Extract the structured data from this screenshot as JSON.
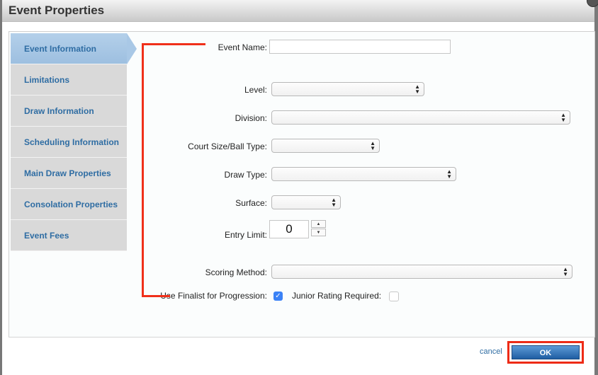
{
  "dialog": {
    "title": "Event Properties"
  },
  "sidebar": {
    "items": [
      {
        "label": "Event Information",
        "active": true
      },
      {
        "label": "Limitations",
        "active": false
      },
      {
        "label": "Draw Information",
        "active": false
      },
      {
        "label": "Scheduling Information",
        "active": false
      },
      {
        "label": "Main Draw Properties",
        "active": false
      },
      {
        "label": "Consolation Properties",
        "active": false
      },
      {
        "label": "Event Fees",
        "active": false
      }
    ]
  },
  "form": {
    "event_name": {
      "label": "Event Name:",
      "value": ""
    },
    "level": {
      "label": "Level:",
      "value": ""
    },
    "division": {
      "label": "Division:",
      "value": ""
    },
    "court_size": {
      "label": "Court Size/Ball Type:",
      "value": ""
    },
    "draw_type": {
      "label": "Draw Type:",
      "value": ""
    },
    "surface": {
      "label": "Surface:",
      "value": ""
    },
    "entry_limit": {
      "label": "Entry Limit:",
      "value": "0"
    },
    "scoring_method": {
      "label": "Scoring Method:",
      "value": ""
    },
    "use_finalist": {
      "label": "Use Finalist for Progression:",
      "checked": true
    },
    "junior_rating": {
      "label": "Junior Rating Required:",
      "checked": false
    }
  },
  "footer": {
    "cancel_label": "cancel",
    "ok_label": "OK"
  },
  "icons": {
    "select_arrows": "▲▼",
    "spin_up": "▲",
    "spin_down": "▼",
    "check": "✓"
  },
  "colors": {
    "highlight": "#ee2b16",
    "link": "#2f6da3",
    "ok_button": "#2a6bb0"
  }
}
